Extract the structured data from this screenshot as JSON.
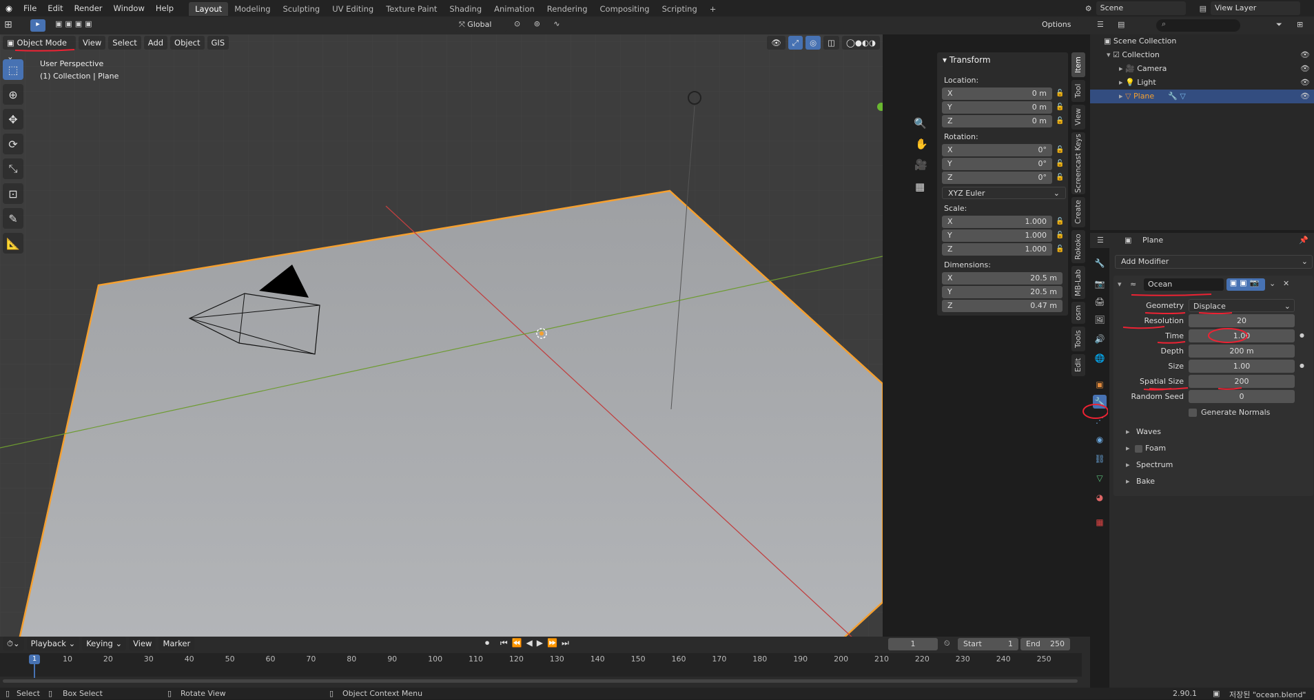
{
  "topbar": {
    "menus": [
      "File",
      "Edit",
      "Render",
      "Window",
      "Help"
    ],
    "workspaces": [
      "Layout",
      "Modeling",
      "Sculpting",
      "UV Editing",
      "Texture Paint",
      "Shading",
      "Animation",
      "Rendering",
      "Compositing",
      "Scripting"
    ],
    "active_workspace": "Layout",
    "plus": "+",
    "scene": "Scene",
    "view_layer": "View Layer"
  },
  "header": {
    "transform": "Global",
    "options": "Options"
  },
  "vp_menu": {
    "mode": "Object Mode",
    "items": [
      "View",
      "Select",
      "Add",
      "Object",
      "GIS"
    ]
  },
  "viewport": {
    "perspective": "User Perspective",
    "collection": "(1) Collection | Plane"
  },
  "npanel": {
    "title": "Transform",
    "location_label": "Location:",
    "location": [
      {
        "axis": "X",
        "value": "0 m"
      },
      {
        "axis": "Y",
        "value": "0 m"
      },
      {
        "axis": "Z",
        "value": "0 m"
      }
    ],
    "rotation_label": "Rotation:",
    "rotation": [
      {
        "axis": "X",
        "value": "0°"
      },
      {
        "axis": "Y",
        "value": "0°"
      },
      {
        "axis": "Z",
        "value": "0°"
      }
    ],
    "rotation_mode": "XYZ Euler",
    "scale_label": "Scale:",
    "scale": [
      {
        "axis": "X",
        "value": "1.000"
      },
      {
        "axis": "Y",
        "value": "1.000"
      },
      {
        "axis": "Z",
        "value": "1.000"
      }
    ],
    "dimensions_label": "Dimensions:",
    "dimensions": [
      {
        "axis": "X",
        "value": "20.5 m"
      },
      {
        "axis": "Y",
        "value": "20.5 m"
      },
      {
        "axis": "Z",
        "value": "0.47 m"
      }
    ]
  },
  "vtabs": [
    "Item",
    "Tool",
    "View",
    "Screencast Keys",
    "Create",
    "Rokoko",
    "MB-Lab",
    "osm",
    "Tools",
    "Edit"
  ],
  "outliner": {
    "root": "Scene Collection",
    "collection": "Collection",
    "items": [
      "Camera",
      "Light",
      "Plane"
    ],
    "selected": "Plane"
  },
  "properties": {
    "object_name": "Plane",
    "add_modifier": "Add Modifier",
    "modifier_name": "Ocean",
    "geometry_label": "Geometry",
    "geometry_value": "Displace",
    "rows": [
      {
        "label": "Resolution",
        "value": "20"
      },
      {
        "label": "Time",
        "value": "1.00"
      },
      {
        "label": "Depth",
        "value": "200 m"
      },
      {
        "label": "Size",
        "value": "1.00"
      },
      {
        "label": "Spatial Size",
        "value": "200"
      },
      {
        "label": "Random Seed",
        "value": "0"
      }
    ],
    "generate_normals": "Generate Normals",
    "subpanels": [
      "Waves",
      "Foam",
      "Spectrum",
      "Bake"
    ]
  },
  "timeline": {
    "menus": [
      "Playback",
      "Keying",
      "View",
      "Marker"
    ],
    "current_frame": "1",
    "start_label": "Start",
    "start": "1",
    "end_label": "End",
    "end": "250",
    "ruler": [
      "1",
      "10",
      "20",
      "30",
      "40",
      "50",
      "60",
      "70",
      "80",
      "90",
      "100",
      "110",
      "120",
      "130",
      "140",
      "150",
      "160",
      "170",
      "180",
      "190",
      "200",
      "210",
      "220",
      "230",
      "240",
      "250"
    ]
  },
  "status": {
    "select": "Select",
    "box_select": "Box Select",
    "rotate_view": "Rotate View",
    "context_menu": "Object Context Menu",
    "version": "2.90.1",
    "saved": "저장된 \"ocean.blend\""
  },
  "colors": {
    "accent": "#4772b3",
    "selection_orange": "#f5a030",
    "annotation_red": "#e02020"
  }
}
